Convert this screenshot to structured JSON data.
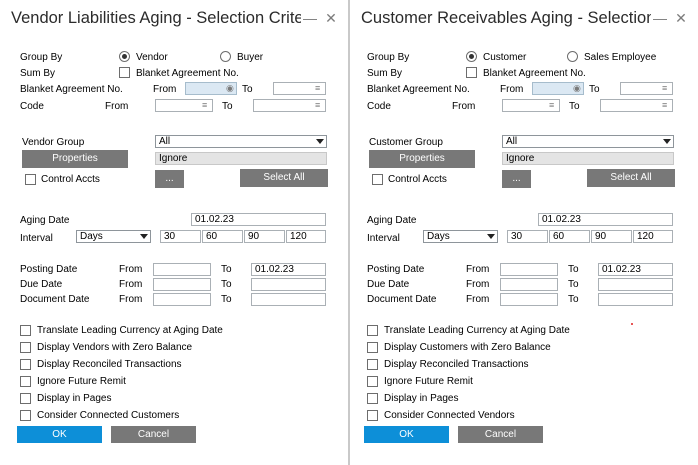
{
  "left": {
    "title": "Vendor Liabilities Aging - Selection Criteria",
    "group_by_label": "Group By",
    "group_by_opt1": "Vendor",
    "group_by_opt2": "Buyer",
    "sum_by_label": "Sum By",
    "sum_by_option": "Blanket Agreement No.",
    "blanket_label": "Blanket Agreement No.",
    "from_label": "From",
    "to_label": "To",
    "code_label": "Code",
    "group_label": "Vendor Group",
    "group_value": "All",
    "properties_label": "Properties",
    "ignore_value": "Ignore",
    "control_accts_label": "Control Accts",
    "ellipsis_label": "...",
    "select_all_label": "Select All",
    "aging_date_label": "Aging Date",
    "aging_date_value": "01.02.23",
    "interval_label": "Interval",
    "interval_value": "Days",
    "interval_1": "30",
    "interval_2": "60",
    "interval_3": "90",
    "interval_4": "120",
    "posting_date_label": "Posting Date",
    "posting_to_value": "01.02.23",
    "due_date_label": "Due Date",
    "document_date_label": "Document Date",
    "opt1": "Translate Leading Currency at Aging Date",
    "opt2": "Display Vendors with Zero Balance",
    "opt3": "Display Reconciled Transactions",
    "opt4": "Ignore Future Remit",
    "opt5": "Display in Pages",
    "opt6": "Consider Connected Customers",
    "ok_label": "OK",
    "cancel_label": "Cancel"
  },
  "right": {
    "title": "Customer Receivables Aging - Selection Criteria",
    "group_by_label": "Group By",
    "group_by_opt1": "Customer",
    "group_by_opt2": "Sales Employee",
    "sum_by_label": "Sum By",
    "sum_by_option": "Blanket Agreement No.",
    "blanket_label": "Blanket Agreement No.",
    "from_label": "From",
    "to_label": "To",
    "code_label": "Code",
    "group_label": "Customer Group",
    "group_value": "All",
    "properties_label": "Properties",
    "ignore_value": "Ignore",
    "control_accts_label": "Control Accts",
    "ellipsis_label": "...",
    "select_all_label": "Select All",
    "aging_date_label": "Aging Date",
    "aging_date_value": "01.02.23",
    "interval_label": "Interval",
    "interval_value": "Days",
    "interval_1": "30",
    "interval_2": "60",
    "interval_3": "90",
    "interval_4": "120",
    "posting_date_label": "Posting Date",
    "posting_to_value": "01.02.23",
    "due_date_label": "Due Date",
    "document_date_label": "Document Date",
    "opt1": "Translate Leading Currency at Aging Date",
    "opt2": "Display Customers with Zero Balance",
    "opt3": "Display Reconciled Transactions",
    "opt4": "Ignore Future Remit",
    "opt5": "Display in Pages",
    "opt6": "Consider Connected Vendors",
    "ok_label": "OK",
    "cancel_label": "Cancel"
  },
  "icons": {
    "minimize": "minimize-icon",
    "close": "close-icon",
    "list": "list-icon",
    "calendar": "calendar-icon"
  }
}
